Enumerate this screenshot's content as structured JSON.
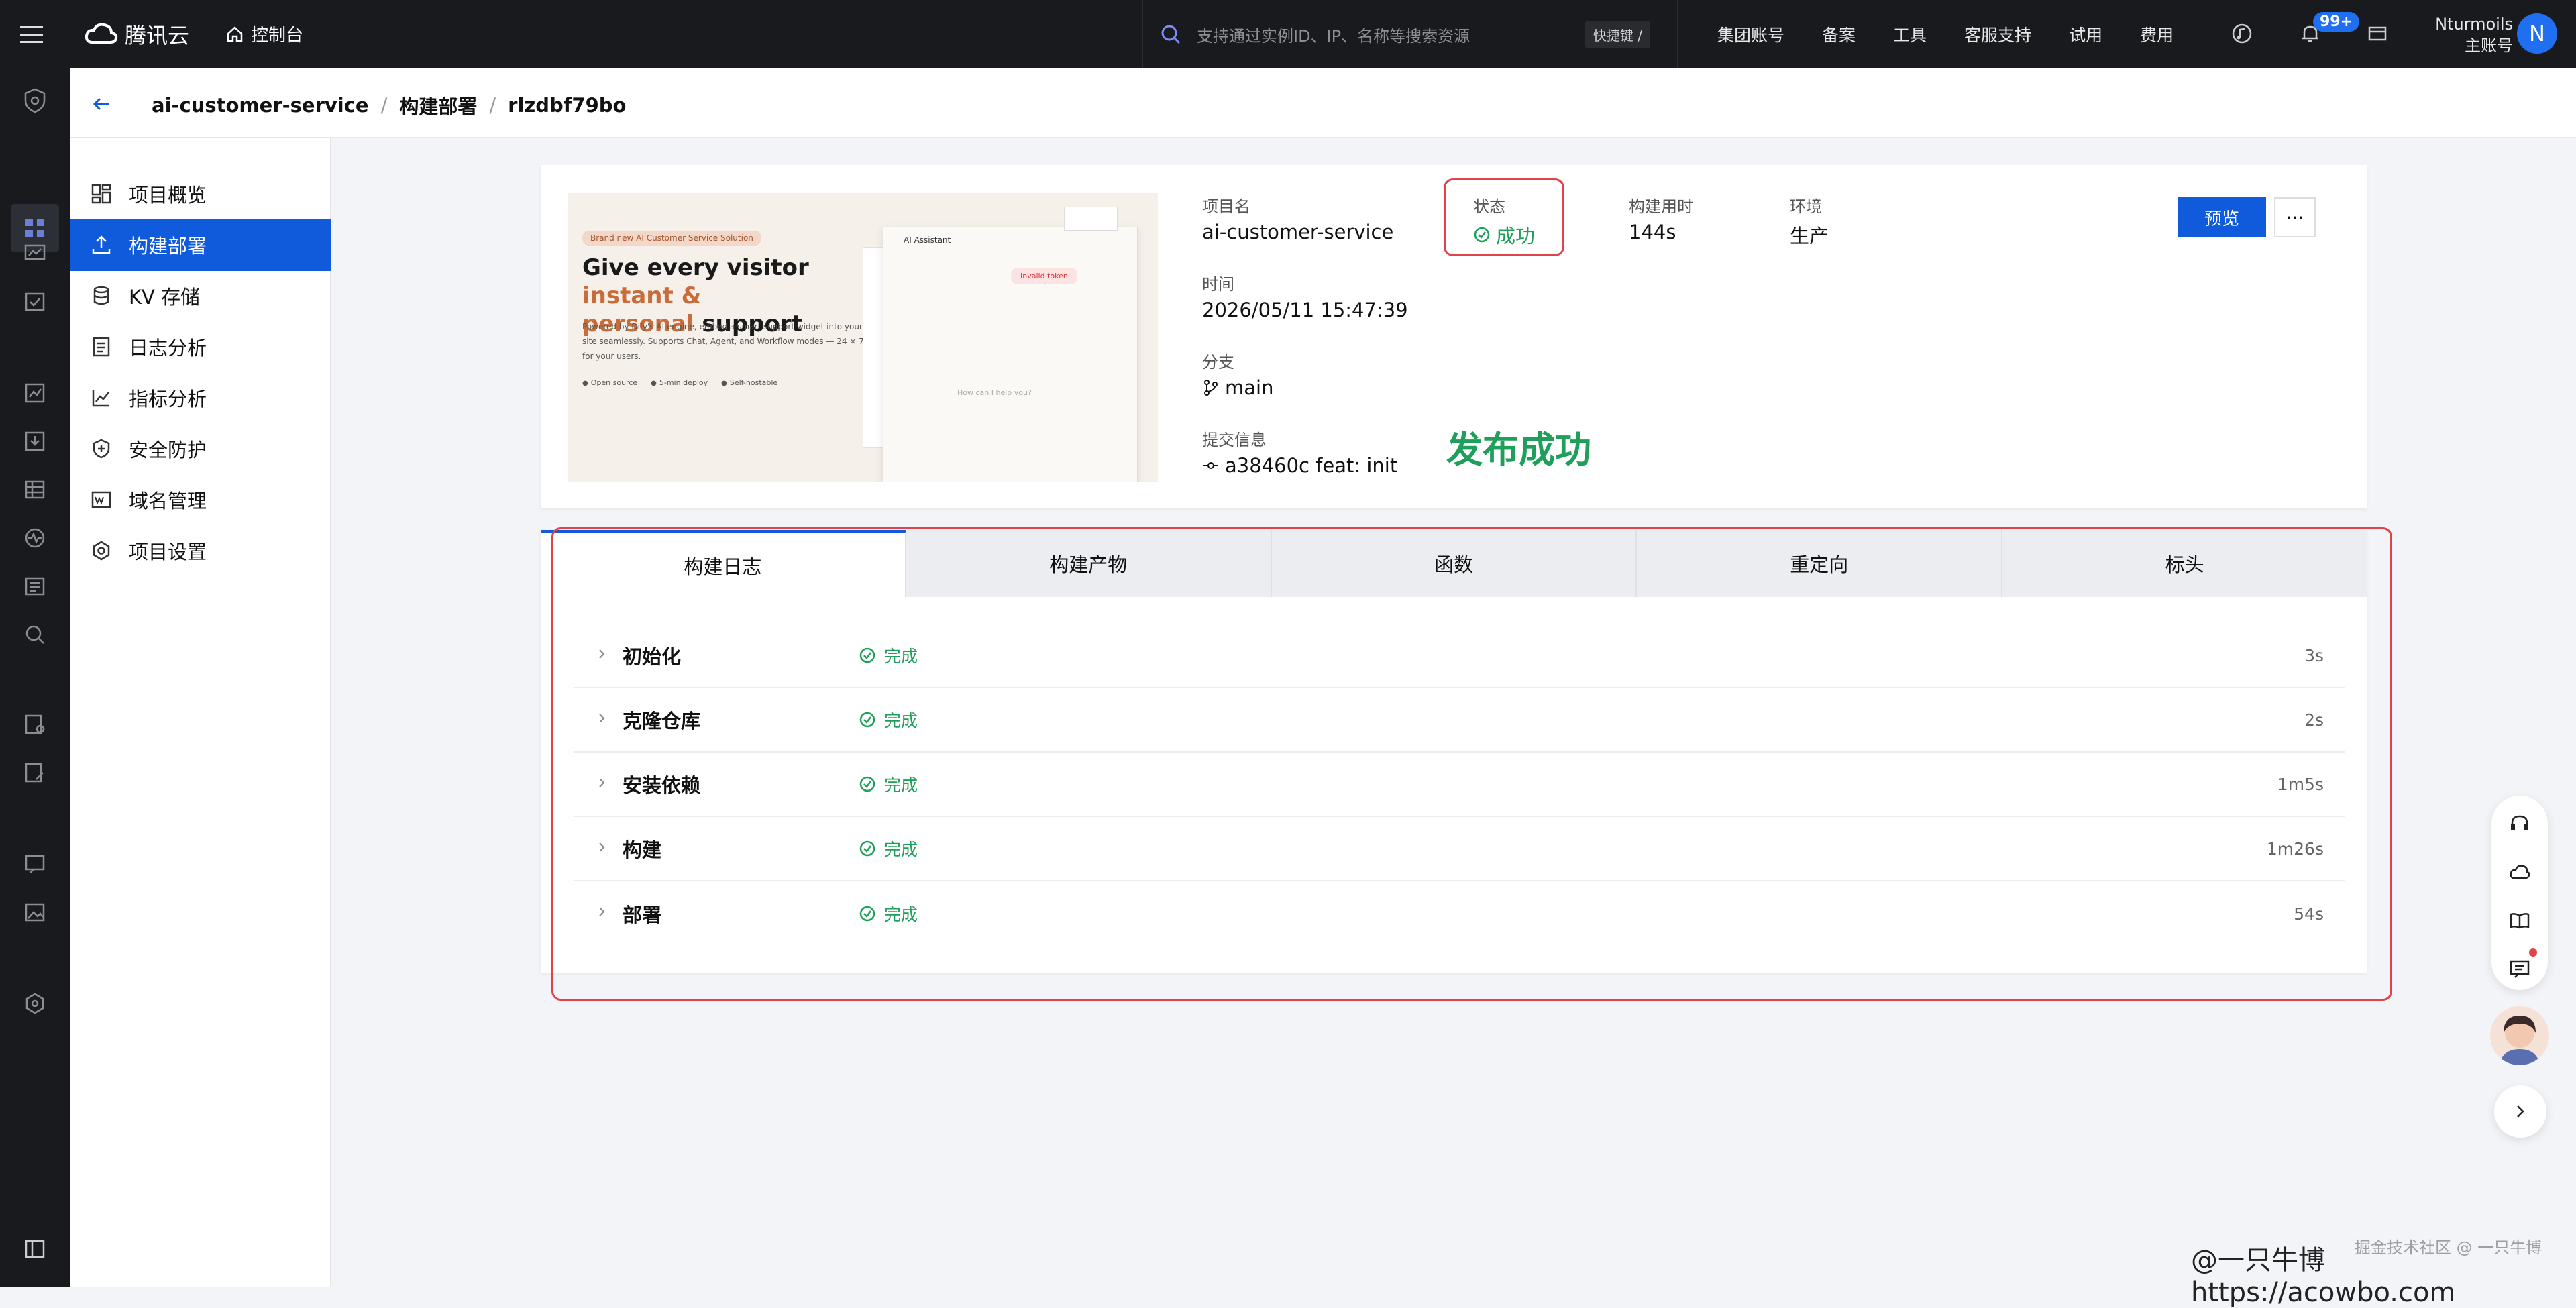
{
  "topbar": {
    "logo_text": "腾讯云",
    "console_label": "控制台",
    "search_placeholder": "支持通过实例ID、IP、名称等搜索资源",
    "shortcut_label": "快捷键 /",
    "links": [
      "集团账号",
      "备案",
      "工具",
      "客服支持",
      "试用",
      "费用"
    ],
    "notification_badge": "99+",
    "user_name": "Nturmoils",
    "user_role": "主账号",
    "avatar_letter": "N"
  },
  "breadcrumb": {
    "project": "ai-customer-service",
    "section": "构建部署",
    "build_id": "rlzdbf79bo"
  },
  "sidemenu": {
    "items": [
      {
        "label": "项目概览",
        "icon": "dashboard-icon"
      },
      {
        "label": "构建部署",
        "icon": "upload-icon"
      },
      {
        "label": "KV 存储",
        "icon": "database-icon"
      },
      {
        "label": "日志分析",
        "icon": "document-icon"
      },
      {
        "label": "指标分析",
        "icon": "line-chart-icon"
      },
      {
        "label": "安全防护",
        "icon": "shield-plus-icon"
      },
      {
        "label": "域名管理",
        "icon": "domain-icon"
      },
      {
        "label": "项目设置",
        "icon": "settings-icon"
      }
    ],
    "active_index": 1
  },
  "preview": {
    "tag": "Brand new AI Customer Service Solution",
    "headline_a": "Give every visitor ",
    "headline_accent_1": "instant &",
    "headline_accent_2": "personal",
    "headline_b": " support",
    "body": "Powered by Dify's AI engine, embed a smart support widget into your site seamlessly. Supports Chat, Agent, and Workflow modes — 24 × 7 for your users.",
    "features": [
      "Open source",
      "5-min deploy",
      "Self-hostable"
    ],
    "window_title": "AI Assistant",
    "error_text": "Invalid token",
    "placeholder": "How can I help you?"
  },
  "info": {
    "project_label": "项目名",
    "project_value": "ai-customer-service",
    "status_label": "状态",
    "status_value": "成功",
    "duration_label": "构建用时",
    "duration_value": "144s",
    "env_label": "环境",
    "env_value": "生产",
    "time_label": "时间",
    "time_value": "2026/05/11 15:47:39",
    "branch_label": "分支",
    "branch_value": "main",
    "commit_label": "提交信息",
    "commit_value": "a38460c feat: init",
    "publish_success": "发布成功",
    "preview_button": "预览",
    "more_button": "···"
  },
  "tabs": [
    "构建日志",
    "构建产物",
    "函数",
    "重定向",
    "标头"
  ],
  "active_tab": 0,
  "steps": [
    {
      "name": "初始化",
      "status": "完成",
      "duration": "3s"
    },
    {
      "name": "克隆仓库",
      "status": "完成",
      "duration": "2s"
    },
    {
      "name": "安装依赖",
      "status": "完成",
      "duration": "1m5s"
    },
    {
      "name": "构建",
      "status": "完成",
      "duration": "1m26s"
    },
    {
      "name": "部署",
      "status": "完成",
      "duration": "54s"
    }
  ],
  "watermark": "@一只牛博 https://acowbo.com",
  "watermark_small": "掘金技术社区 @ 一只牛博",
  "colors": {
    "accent": "#0f5bdc",
    "success": "#1ea05a",
    "highlight": "#e0434a",
    "topbar": "#191a1d"
  }
}
